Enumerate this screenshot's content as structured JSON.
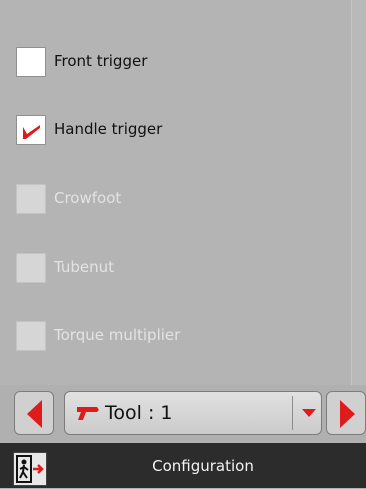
{
  "options": [
    {
      "label": "Front trigger",
      "checked": false,
      "enabled": true
    },
    {
      "label": "Handle trigger",
      "checked": true,
      "enabled": true
    },
    {
      "label": "Crowfoot",
      "checked": false,
      "enabled": false
    },
    {
      "label": "Tubenut",
      "checked": false,
      "enabled": false
    },
    {
      "label": "Torque multiplier",
      "checked": false,
      "enabled": false
    }
  ],
  "tool_selector": {
    "label": "Tool : 1"
  },
  "bottom_bar": {
    "title": "Configuration"
  },
  "icons": {
    "prev": "left-arrow-icon",
    "next": "right-arrow-icon",
    "tool": "drill-tool-icon",
    "dropdown": "dropdown-triangle-icon",
    "exit": "exit-door-icon"
  },
  "colors": {
    "accent": "#e01b1b",
    "background": "#b4b4b4",
    "bar": "#2c2c2c"
  }
}
